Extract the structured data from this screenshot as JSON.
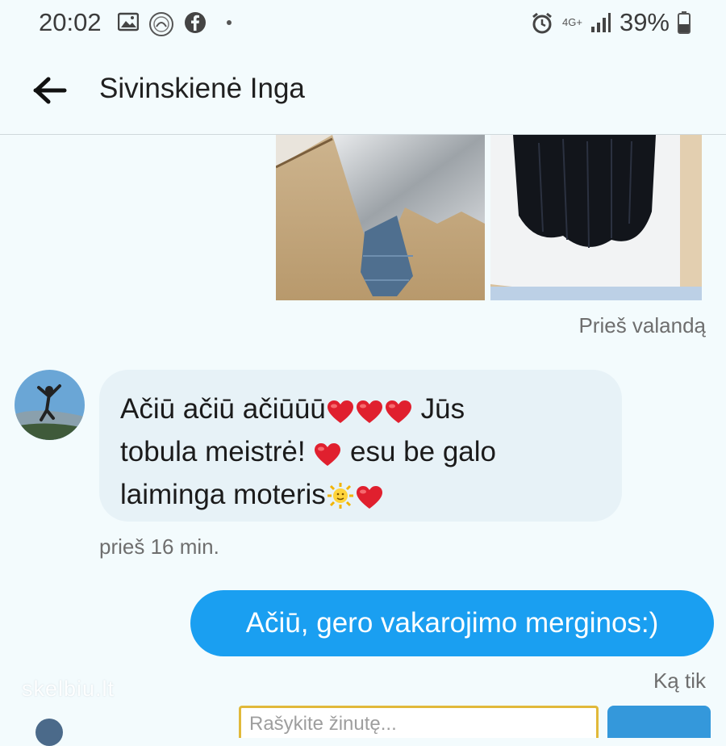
{
  "status_bar": {
    "time": "20:02",
    "network_type": "4G+",
    "battery": "39%",
    "icons": [
      "gallery-icon",
      "app-icon",
      "facebook-icon",
      "dot-icon",
      "alarm-icon",
      "signal-icon",
      "battery-icon"
    ]
  },
  "header": {
    "contact_name": "Sivinskienė Inga"
  },
  "messages": [
    {
      "direction": "outgoing",
      "type": "photos",
      "photos": [
        "photo-silver-cape-back",
        "photo-long-dark-hair"
      ],
      "timestamp": "Prieš valandą"
    },
    {
      "direction": "incoming",
      "type": "text",
      "lines": [
        "Ačiū ačiū ačiūūū",
        "Jūs",
        "tobula meistrė!",
        "esu be galo",
        "laiminga moteris"
      ],
      "emojis": [
        "heart",
        "sun"
      ],
      "timestamp": "prieš 16 min."
    },
    {
      "direction": "outgoing",
      "type": "text",
      "text": "Ačiū, gero vakarojimo merginos:)",
      "timestamp": "Ką tik"
    }
  ],
  "watermark": "skelbiu.lt",
  "compose": {
    "placeholder": "Rašykite žinutę..."
  },
  "colors": {
    "background": "#f3fbfd",
    "incoming_bubble": "#e7f2f7",
    "outgoing_bubble": "#1a9ff1",
    "heart": "#e0202e",
    "timestamp": "#6e6e6e"
  }
}
